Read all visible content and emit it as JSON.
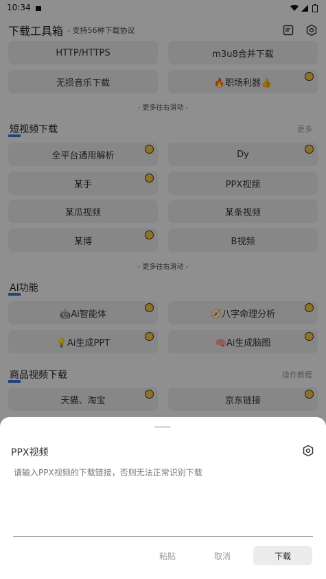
{
  "status": {
    "time": "10:34"
  },
  "header": {
    "title": "下载工具箱",
    "subtitle": "- 支持56种下载协议"
  },
  "top_buttons": [
    "HTTP/HTTPS",
    "m3u8合并下载",
    "无损音乐下载",
    "🔥职场利器👍"
  ],
  "scroll_hint": "- 更多往右滑动 -",
  "sections": {
    "short_video": {
      "title": "短视频下载",
      "more": "更多",
      "items": [
        "全平台通用解析",
        "Dy",
        "某手",
        "PPX视频",
        "某瓜视频",
        "某条视频",
        "某博",
        "B视频"
      ]
    },
    "ai": {
      "title": "AI功能",
      "items": [
        "🤖Ai智能体",
        "🧭八字命理分析",
        "💡Ai生成PPT",
        "🧠Ai生成脑图"
      ]
    },
    "product": {
      "title": "商品视频下载",
      "more": "操作教程",
      "items": [
        "天猫、淘宝",
        "京东链接"
      ]
    }
  },
  "sheet": {
    "title": "PPX视频",
    "placeholder": "请输入PPX视频的下载链接，否则无法正常识别下载",
    "paste": "粘贴",
    "cancel": "取消",
    "download": "下载"
  }
}
